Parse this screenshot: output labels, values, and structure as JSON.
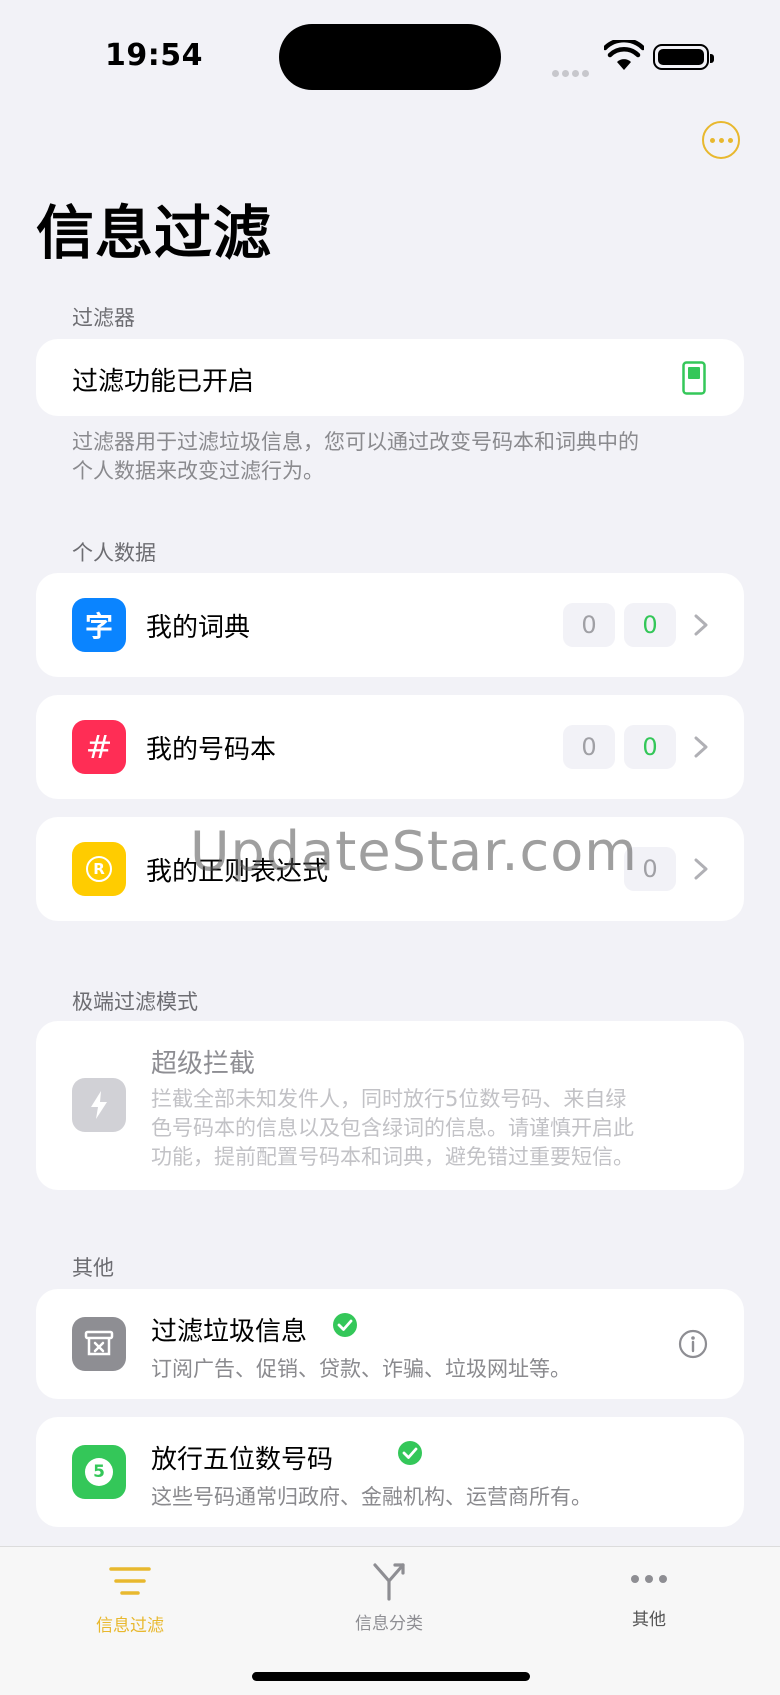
{
  "status_bar": {
    "time": "19:54"
  },
  "page": {
    "title": "信息过滤"
  },
  "filter_section": {
    "label": "过滤器",
    "row_label": "过滤功能已开启",
    "description_line1": "过滤器用于过滤垃圾信息，您可以通过改变号码本和词典中的",
    "description_line2": "个人数据来改变过滤行为。"
  },
  "personal_section": {
    "label": "个人数据",
    "items": [
      {
        "label": "我的词典",
        "icon_glyph": "字",
        "icon": "dictionary-icon",
        "color": "#0a84ff",
        "count_gray": "0",
        "count_green": "0"
      },
      {
        "label": "我的号码本",
        "icon_glyph": "#",
        "icon": "hash-icon",
        "color": "#ff2d55",
        "count_gray": "0",
        "count_green": "0"
      },
      {
        "label": "我的正则表达式",
        "icon_glyph": "R",
        "icon": "regex-icon",
        "color": "#ffcc00",
        "count_gray": "0"
      }
    ]
  },
  "extreme_section": {
    "label": "极端过滤模式",
    "title": "超级拦截",
    "description_line1": "拦截全部未知发件人，同时放行5位数号码、来自绿",
    "description_line2": "色号码本的信息以及包含绿词的信息。请谨慎开启此",
    "description_line3": "功能，提前配置号码本和词典，避免错过重要短信。"
  },
  "other_section": {
    "label": "其他",
    "items": [
      {
        "title": "过滤垃圾信息",
        "subtitle": "订阅广告、促销、贷款、诈骗、垃圾网址等。",
        "icon": "trash-box-icon",
        "color": "#8e8e93"
      },
      {
        "title": "放行五位数号码",
        "subtitle": "这些号码通常归政府、金融机构、运营商所有。",
        "icon": "five-icon",
        "color": "#34c759"
      }
    ]
  },
  "watermark": "UpdateStar.com",
  "tabbar": {
    "tabs": [
      {
        "label": "信息过滤",
        "icon": "filter-lines-icon",
        "active": true
      },
      {
        "label": "信息分类",
        "icon": "branch-icon",
        "active": false
      },
      {
        "label": "其他",
        "icon": "ellipsis-icon",
        "active": false
      }
    ]
  },
  "colors": {
    "accent": "#e8b82e",
    "green": "#34c759",
    "background": "#f2f2f7"
  }
}
